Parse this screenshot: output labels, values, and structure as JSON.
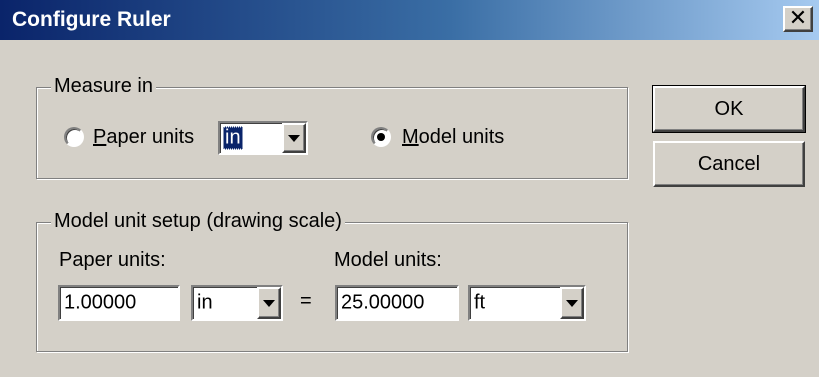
{
  "window": {
    "title": "Configure Ruler",
    "close_glyph": "✕"
  },
  "measure_group": {
    "label": "Measure in",
    "paper_units_label": "Paper units",
    "paper_units_selected": false,
    "paper_units_combo_value": "in",
    "model_units_label": "Model units",
    "model_units_selected": true
  },
  "setup_group": {
    "label": "Model unit setup (drawing scale)",
    "paper_units_heading": "Paper units:",
    "paper_value": "1.00000",
    "paper_unit": "in",
    "equals": "=",
    "model_units_heading": "Model units:",
    "model_value": "25.00000",
    "model_unit": "ft"
  },
  "buttons": {
    "ok_label": "OK",
    "cancel_label": "Cancel"
  },
  "icons": [
    "close-icon",
    "chevron-down-icon",
    "radio-dot-icon"
  ]
}
